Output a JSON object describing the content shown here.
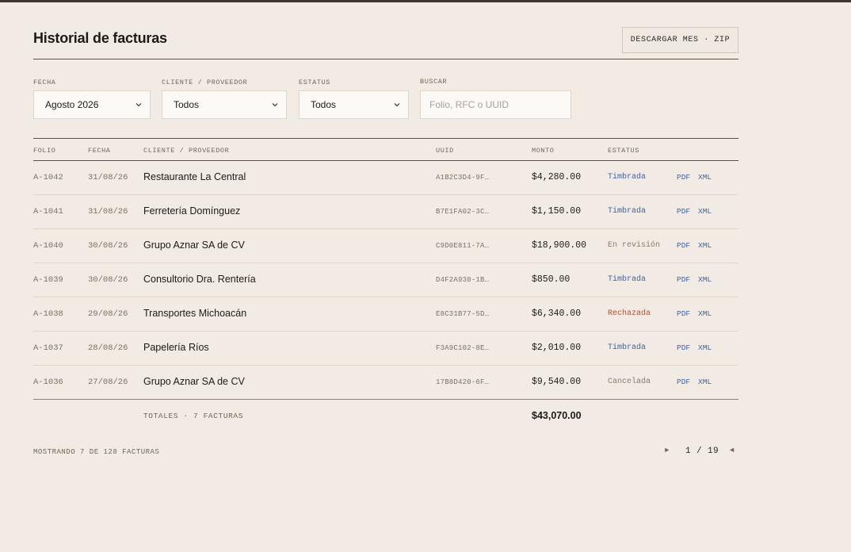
{
  "header": {
    "title": "Historial de facturas",
    "download_label": "DESCARGAR MES · ZIP"
  },
  "filters": {
    "fecha": {
      "label": "FECHA",
      "value": "Agosto 2026"
    },
    "cliente": {
      "label": "CLIENTE / PROVEEDOR",
      "value": "Todos"
    },
    "estatus": {
      "label": "ESTATUS",
      "value": "Todos"
    },
    "buscar": {
      "label": "BUSCAR",
      "placeholder": "Folio, RFC o UUID"
    }
  },
  "table": {
    "columns": [
      "FOLIO",
      "FECHA",
      "CLIENTE / PROVEEDOR",
      "UUID",
      "MONTO",
      "ESTATUS"
    ],
    "rows": [
      {
        "folio": "A-1042",
        "fecha": "31/08/26",
        "cliente": "Restaurante La Central",
        "uuid": "A1B2C3D4-9F…",
        "monto": "$4,280.00",
        "estatus": "Timbrada",
        "pdf": "PDF",
        "xml": "XML"
      },
      {
        "folio": "A-1041",
        "fecha": "31/08/26",
        "cliente": "Ferretería Domínguez",
        "uuid": "B7E1FA02-3C…",
        "monto": "$1,150.00",
        "estatus": "Timbrada",
        "pdf": "PDF",
        "xml": "XML"
      },
      {
        "folio": "A-1040",
        "fecha": "30/08/26",
        "cliente": "Grupo Aznar SA de CV",
        "uuid": "C9D0E811-7A…",
        "monto": "$18,900.00",
        "estatus": "En revisión",
        "pdf": "PDF",
        "xml": "XML"
      },
      {
        "folio": "A-1039",
        "fecha": "30/08/26",
        "cliente": "Consultorio Dra. Rentería",
        "uuid": "D4F2A930-1B…",
        "monto": "$850.00",
        "estatus": "Timbrada",
        "pdf": "PDF",
        "xml": "XML"
      },
      {
        "folio": "A-1038",
        "fecha": "29/08/26",
        "cliente": "Transportes Michoacán",
        "uuid": "E8C31B77-5D…",
        "monto": "$6,340.00",
        "estatus": "Rechazada",
        "pdf": "PDF",
        "xml": "XML"
      },
      {
        "folio": "A-1037",
        "fecha": "28/08/26",
        "cliente": "Papelería Ríos",
        "uuid": "F3A9C102-8E…",
        "monto": "$2,010.00",
        "estatus": "Timbrada",
        "pdf": "PDF",
        "xml": "XML"
      },
      {
        "folio": "A-1036",
        "fecha": "27/08/26",
        "cliente": "Grupo Aznar SA de CV",
        "uuid": "17B8D420-6F…",
        "monto": "$9,540.00",
        "estatus": "Cancelada",
        "pdf": "PDF",
        "xml": "XML"
      }
    ]
  },
  "status_colors": {
    "Timbrada": "#3f62a8",
    "En revisión": "#857c74",
    "Rechazada": "#b5502f",
    "Cancelada": "#857c74"
  },
  "totals": {
    "label": "TOTALES · 7 FACTURAS",
    "amount": "$43,070.00"
  },
  "footer": {
    "count": "MOSTRANDO 7 DE 128 FACTURAS",
    "pager": "1 / 19",
    "next_icon": "►",
    "prev_icon": "◄"
  }
}
